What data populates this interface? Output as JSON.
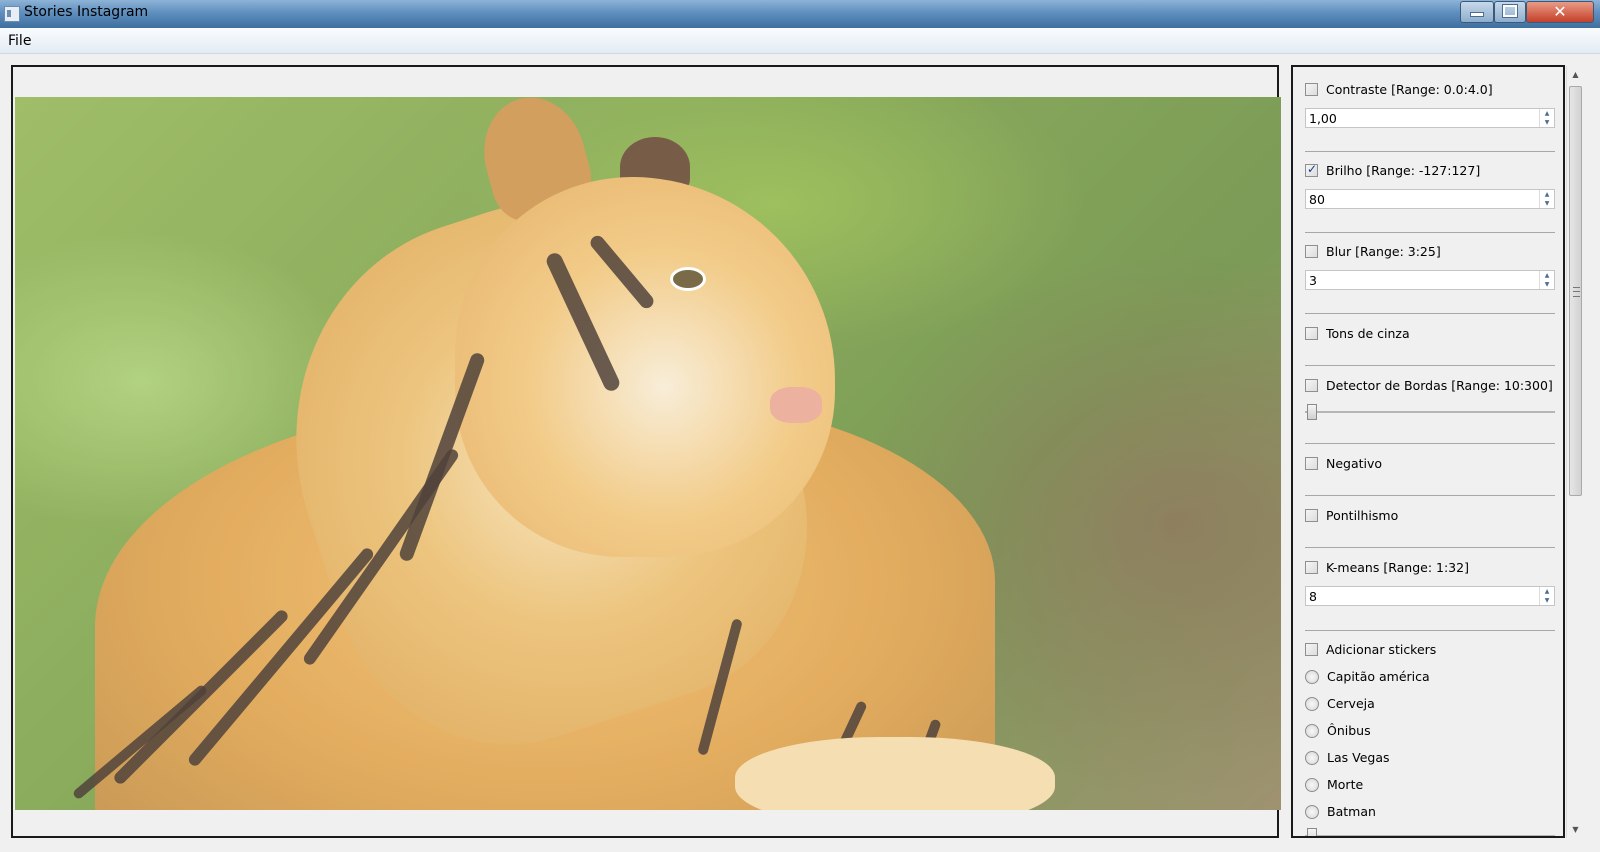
{
  "window": {
    "title": "Stories Instagram"
  },
  "menu": {
    "file": "File"
  },
  "controls": {
    "contraste": {
      "label": "Contraste [Range: 0.0:4.0]",
      "value": "1,00",
      "checked": false
    },
    "brilho": {
      "label": "Brilho [Range: -127:127]",
      "value": "80",
      "checked": true
    },
    "blur": {
      "label": "Blur [Range: 3:25]",
      "value": "3",
      "checked": false
    },
    "tons_cinza": {
      "label": "Tons de cinza",
      "checked": false
    },
    "bordas": {
      "label": "Detector de Bordas [Range: 10:300]",
      "checked": false,
      "slider_value": 10
    },
    "negativo": {
      "label": "Negativo",
      "checked": false
    },
    "pontilhismo": {
      "label": "Pontilhismo",
      "checked": false
    },
    "kmeans": {
      "label": "K-means [Range: 1:32]",
      "value": "8",
      "checked": false
    },
    "stickers": {
      "label": "Adicionar stickers",
      "checked": false,
      "options": [
        "Capitão américa",
        "Cerveja",
        "Ônibus",
        "Las Vegas",
        "Morte",
        "Batman"
      ]
    }
  }
}
